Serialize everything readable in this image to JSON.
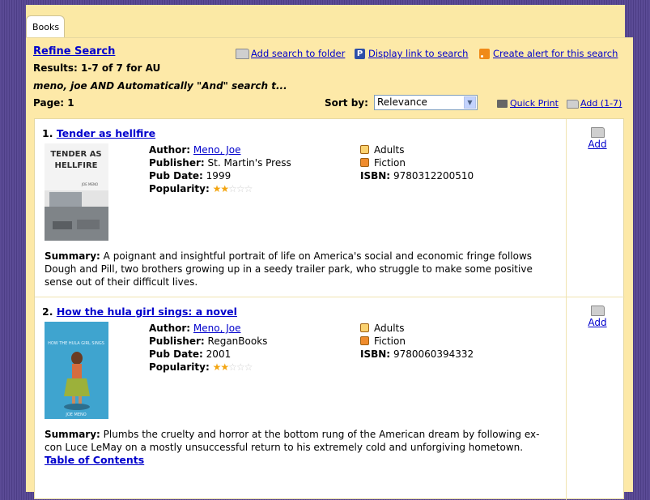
{
  "tab": {
    "label": "Books"
  },
  "header": {
    "refine_search": "Refine Search",
    "results_text": "Results: 1-7 of 7 for AU",
    "query_text": "meno, joe AND Automatically \"And\" search t...",
    "page_text": "Page: 1",
    "add_search_to_folder": "Add search to folder",
    "display_link": "Display link to search",
    "create_alert": "Create alert for this search",
    "sort_label": "Sort by:",
    "sort_value": "Relevance",
    "quick_print": "Quick Print",
    "add_range": "Add (1-7)"
  },
  "labels": {
    "author": "Author:",
    "publisher": "Publisher:",
    "pub_date": "Pub Date:",
    "popularity": "Popularity:",
    "isbn": "ISBN:",
    "summary": "Summary:",
    "add": "Add"
  },
  "books": [
    {
      "number": "1.",
      "title": "Tender as hellfire",
      "author": "Meno, Joe",
      "publisher": "St. Martin's Press",
      "pub_date": "1999",
      "popularity_stars": 2,
      "audience": "Adults",
      "genre": "Fiction",
      "isbn": "9780312200510",
      "cover_text_top": "TENDER AS",
      "cover_text_bottom": "HELLFIRE",
      "cover_author": "JOE MENO",
      "summary": "A poignant and insightful portrait of life on America's social and economic fringe follows Dough and Pill, two brothers growing up in a seedy trailer park, who struggle to make some positive sense out of their difficult lives."
    },
    {
      "number": "2.",
      "title": "How the hula girl sings: a novel",
      "author": "Meno, Joe",
      "publisher": "ReganBooks",
      "pub_date": "2001",
      "popularity_stars": 2,
      "audience": "Adults",
      "genre": "Fiction",
      "isbn": "9780060394332",
      "cover_text": "HOW THE HULA GIRL SINGS",
      "cover_author": "JOE MENO",
      "summary": "Plumbs the cruelty and horror at the bottom rung of the American dream by following ex-con Luce LeMay on a mostly unsuccessful return to his extremely cold and unforgiving hometown.",
      "toc_link": "Table of Contents"
    }
  ],
  "colors": {
    "background": "#5a4a94",
    "panel": "#fde9a8",
    "link": "#0000cc"
  }
}
